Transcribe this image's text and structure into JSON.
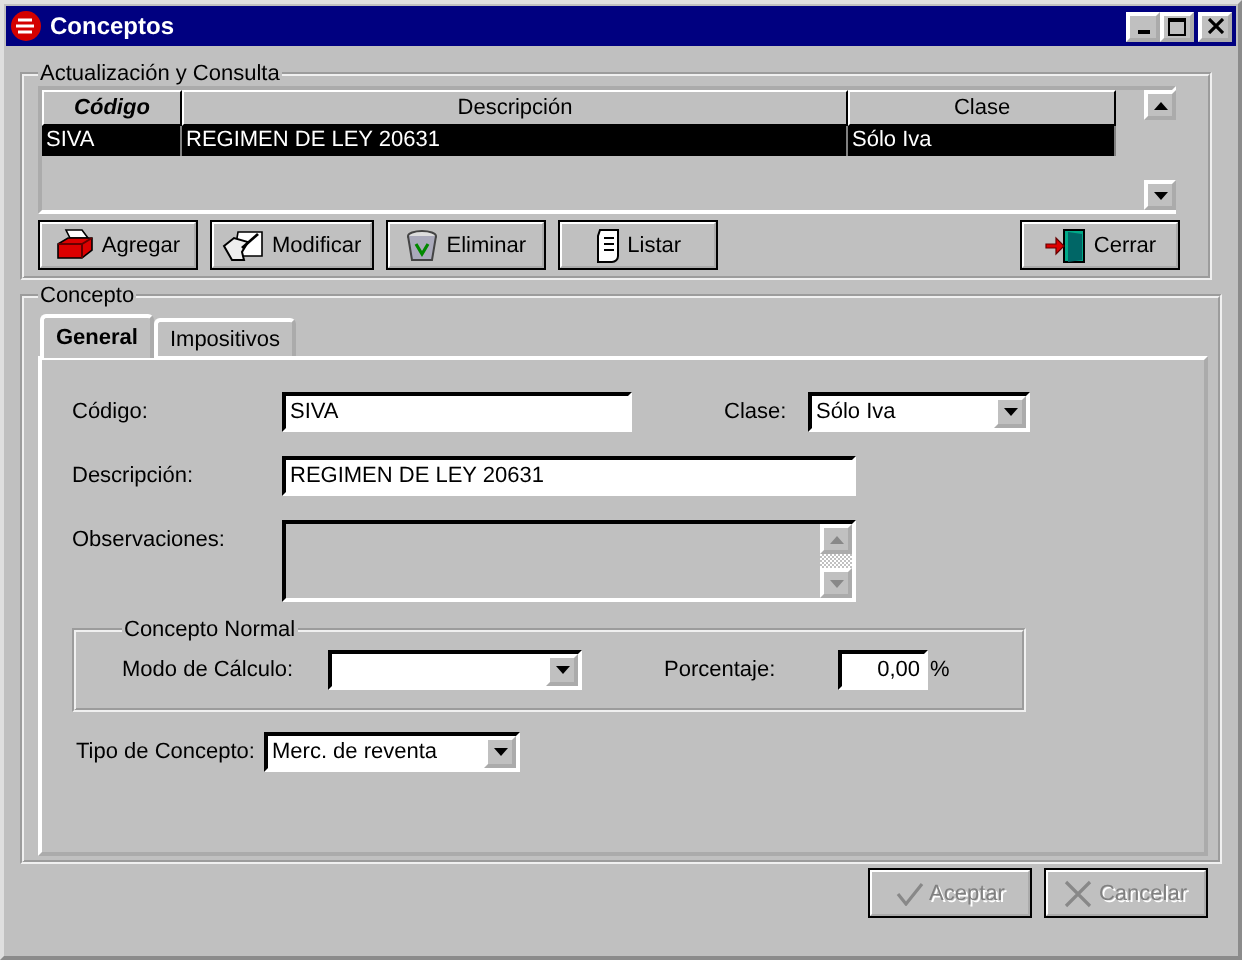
{
  "window": {
    "title": "Conceptos"
  },
  "list_group": {
    "title": "Actualización y Consulta",
    "columns": [
      {
        "label": "Código",
        "sorted": true
      },
      {
        "label": "Descripción",
        "sorted": false
      },
      {
        "label": "Clase",
        "sorted": false
      }
    ],
    "rows": [
      {
        "cells": [
          "SIVA",
          "REGIMEN DE LEY 20631",
          "Sólo Iva"
        ],
        "selected": true
      }
    ]
  },
  "list_buttons": [
    {
      "label": "Agregar",
      "kind": "add"
    },
    {
      "label": "Modificar",
      "kind": "edit"
    },
    {
      "label": "Eliminar",
      "kind": "delete"
    },
    {
      "label": "Listar",
      "kind": "list"
    },
    {
      "label": "Cerrar",
      "kind": "close"
    }
  ],
  "detail_group": {
    "title": "Concepto",
    "tabs": [
      {
        "label": "General",
        "selected": true
      },
      {
        "label": "Impositivos",
        "selected": false
      }
    ],
    "codigo": {
      "label": "Código:",
      "value": "SIVA"
    },
    "clase": {
      "label": "Clase:",
      "value": "Sólo Iva"
    },
    "descripcion": {
      "label": "Descripción:",
      "value": "REGIMEN DE LEY 20631"
    },
    "observaciones": {
      "label": "Observaciones:",
      "disabled": true
    },
    "normal_group": {
      "title": "Concepto Normal",
      "modo": {
        "label": "Modo de Cálculo:"
      },
      "porcentaje": {
        "label": "Porcentaje:",
        "value": "0,00",
        "unit": "%"
      }
    },
    "tipo": {
      "label": "Tipo de Concepto:",
      "value": "Merc. de reventa"
    }
  },
  "footer_buttons": [
    {
      "label": "Aceptar",
      "kind": "accept",
      "disabled": true
    },
    {
      "label": "Cancelar",
      "kind": "cancel",
      "disabled": true
    }
  ]
}
